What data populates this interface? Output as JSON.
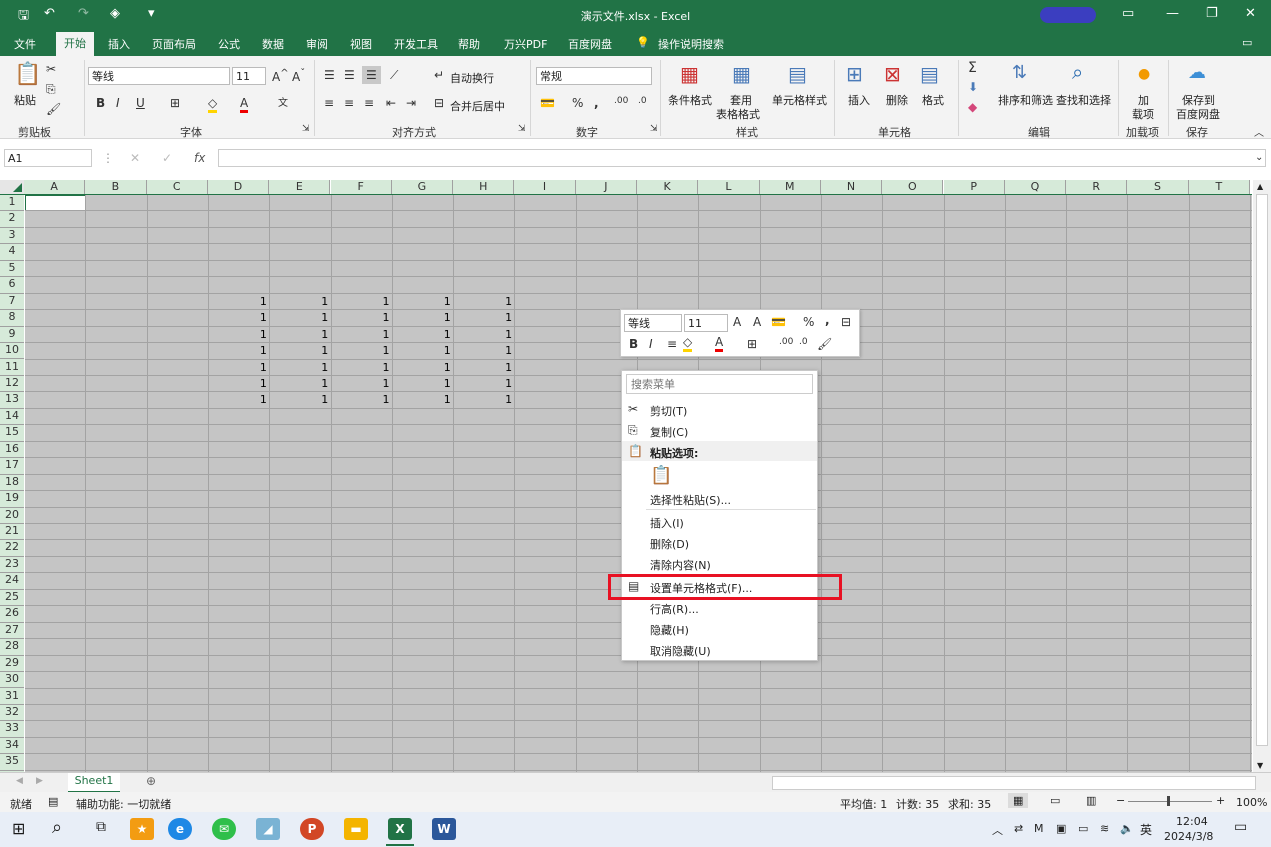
{
  "window": {
    "title": "演示文件.xlsx  -  Excel"
  },
  "menu": {
    "tabs": [
      "文件",
      "开始",
      "插入",
      "页面布局",
      "公式",
      "数据",
      "审阅",
      "视图",
      "开发工具",
      "帮助",
      "万兴PDF",
      "百度网盘",
      "操作说明搜索"
    ],
    "active": "开始"
  },
  "ribbon": {
    "paste": "粘贴",
    "font_name": "等线",
    "font_size": "11",
    "wrap_text": "自动换行",
    "merge_center": "合并后居中",
    "number_format": "常规",
    "cond_format": "条件格式",
    "table_format_1": "套用",
    "table_format_2": "表格格式",
    "cell_style": "单元格样式",
    "insert": "插入",
    "delete": "删除",
    "format": "格式",
    "sort_filter": "排序和筛选",
    "find_select": "查找和选择",
    "addin_1": "加",
    "addin_2": "载项",
    "save_1": "保存到",
    "save_2": "百度网盘",
    "groups": [
      "剪贴板",
      "字体",
      "对齐方式",
      "数字",
      "样式",
      "单元格",
      "编辑",
      "加载项",
      "保存"
    ]
  },
  "formula_bar": {
    "name_box": "A1",
    "fx": "fx"
  },
  "grid": {
    "columns": [
      "A",
      "B",
      "C",
      "D",
      "E",
      "F",
      "G",
      "H",
      "I",
      "J",
      "K",
      "L",
      "M",
      "N",
      "O",
      "P",
      "Q",
      "R",
      "S",
      "T"
    ],
    "rows": [
      "1",
      "2",
      "3",
      "4",
      "5",
      "6",
      "7",
      "8",
      "9",
      "10",
      "11",
      "12",
      "13",
      "14",
      "15",
      "16",
      "17",
      "18",
      "19",
      "20",
      "21",
      "22",
      "23",
      "24",
      "25",
      "26",
      "27",
      "28",
      "29",
      "30",
      "31",
      "32",
      "33",
      "34",
      "35"
    ],
    "value": "1"
  },
  "mini_toolbar": {
    "font": "等线",
    "size": "11",
    "percent": "%",
    "comma": ",",
    "bold": "B",
    "italic": "I",
    "font_color": "A"
  },
  "context_menu": {
    "search_placeholder": "搜索菜单",
    "items": [
      "剪切(T)",
      "复制(C)",
      "粘贴选项:",
      "选择性粘贴(S)...",
      "插入(I)",
      "删除(D)",
      "清除内容(N)",
      "设置单元格格式(F)...",
      "行高(R)...",
      "隐藏(H)",
      "取消隐藏(U)"
    ],
    "highlight_color": "#e81123"
  },
  "sheet_tabs": {
    "active": "Sheet1"
  },
  "status": {
    "ready": "就绪",
    "accessibility": "辅助功能: 一切就绪",
    "average": "平均值: 1",
    "count": "计数: 35",
    "sum": "求和: 35",
    "zoom": "100%"
  },
  "taskbar": {
    "time": "12:04",
    "date": "2024/3/8",
    "lang": "英"
  }
}
